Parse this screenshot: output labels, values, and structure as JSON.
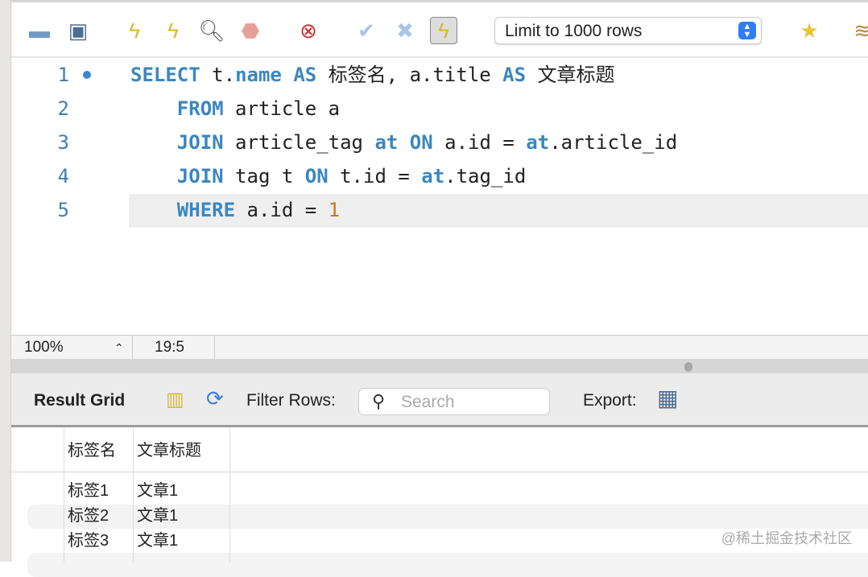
{
  "toolbar": {
    "icons": [
      "open-folder-icon",
      "save-icon",
      "execute-icon",
      "execute-current-icon",
      "explain-icon",
      "stop-icon",
      "stop-on-error-icon",
      "commit-icon",
      "rollback-icon",
      "autocommit-icon",
      "add-snippet-icon",
      "beautify-icon"
    ],
    "limit_label": "Limit to 1000 rows"
  },
  "editor": {
    "lines": [
      {
        "n": "1",
        "tokens": [
          [
            "kw",
            "SELECT"
          ],
          [
            "t",
            " t."
          ],
          [
            "kw",
            "name"
          ],
          [
            "t",
            " "
          ],
          [
            "kw",
            "AS"
          ],
          [
            "t",
            " 标签名, a.title "
          ],
          [
            "kw",
            "AS"
          ],
          [
            "t",
            " 文章标题"
          ]
        ]
      },
      {
        "n": "2",
        "tokens": [
          [
            "t",
            "    "
          ],
          [
            "kw",
            "FROM"
          ],
          [
            "t",
            " article a"
          ]
        ]
      },
      {
        "n": "3",
        "tokens": [
          [
            "t",
            "    "
          ],
          [
            "kw",
            "JOIN"
          ],
          [
            "t",
            " article_tag "
          ],
          [
            "kw",
            "at"
          ],
          [
            "t",
            " "
          ],
          [
            "kw",
            "ON"
          ],
          [
            "t",
            " a.id = "
          ],
          [
            "kw",
            "at"
          ],
          [
            "t",
            ".article_id"
          ]
        ]
      },
      {
        "n": "4",
        "tokens": [
          [
            "t",
            "    "
          ],
          [
            "kw",
            "JOIN"
          ],
          [
            "t",
            " tag t "
          ],
          [
            "kw",
            "ON"
          ],
          [
            "t",
            " t.id = "
          ],
          [
            "kw",
            "at"
          ],
          [
            "t",
            ".tag_id"
          ]
        ]
      },
      {
        "n": "5",
        "tokens": [
          [
            "t",
            "    "
          ],
          [
            "kw",
            "WHERE"
          ],
          [
            "t",
            " a.id = "
          ],
          [
            "num",
            "1"
          ]
        ]
      }
    ]
  },
  "status": {
    "zoom": "100%",
    "cursor": "19:5"
  },
  "result": {
    "title": "Result Grid",
    "filter_label": "Filter Rows:",
    "search_placeholder": "Search",
    "export_label": "Export:",
    "columns": [
      "标签名",
      "文章标题"
    ],
    "rows": [
      [
        "标签1",
        "文章1"
      ],
      [
        "标签2",
        "文章1"
      ],
      [
        "标签3",
        "文章1"
      ]
    ]
  },
  "watermark": "@稀土掘金技术社区"
}
